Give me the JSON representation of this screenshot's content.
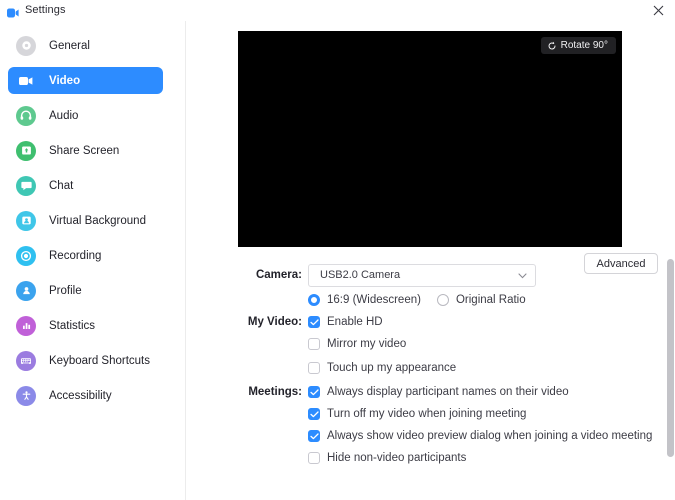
{
  "window": {
    "title": "Settings",
    "app_icon": "zoom-camera-icon",
    "close_icon": "close-icon"
  },
  "sidebar": {
    "items": [
      {
        "label": "General",
        "icon": "gear-icon",
        "color": "#d6d6da",
        "active": false
      },
      {
        "label": "Video",
        "icon": "video-camera-icon",
        "color": "#2d8cff",
        "active": true
      },
      {
        "label": "Audio",
        "icon": "headphones-icon",
        "color": "#5ec98f",
        "active": false
      },
      {
        "label": "Share Screen",
        "icon": "share-screen-icon",
        "color": "#3fbf6f",
        "active": false
      },
      {
        "label": "Chat",
        "icon": "chat-bubble-icon",
        "color": "#3fc7b4",
        "active": false
      },
      {
        "label": "Virtual Background",
        "icon": "virtual-background-icon",
        "color": "#3fc6e8",
        "active": false
      },
      {
        "label": "Recording",
        "icon": "record-circle-icon",
        "color": "#2fc0f0",
        "active": false
      },
      {
        "label": "Profile",
        "icon": "person-icon",
        "color": "#3ba3ee",
        "active": false
      },
      {
        "label": "Statistics",
        "icon": "bar-chart-icon",
        "color": "#c060d8",
        "active": false
      },
      {
        "label": "Keyboard Shortcuts",
        "icon": "keyboard-icon",
        "color": "#9b7ce0",
        "active": false
      },
      {
        "label": "Accessibility",
        "icon": "accessibility-icon",
        "color": "#8b8ae8",
        "active": false
      }
    ]
  },
  "video_preview": {
    "rotate_label": "Rotate 90°",
    "rotate_icon": "rotate-icon",
    "background_color": "#000000"
  },
  "form": {
    "camera": {
      "label": "Camera:",
      "selected": "USB2.0 Camera",
      "chevron_icon": "chevron-down-icon",
      "aspect_ratio": [
        {
          "label": "16:9 (Widescreen)",
          "checked": true
        },
        {
          "label": "Original Ratio",
          "checked": false
        }
      ]
    },
    "my_video": {
      "label": "My Video:",
      "options": [
        {
          "label": "Enable HD",
          "checked": true
        },
        {
          "label": "Mirror my video",
          "checked": false
        },
        {
          "label": "Touch up my appearance",
          "checked": false
        }
      ]
    },
    "meetings": {
      "label": "Meetings:",
      "options": [
        {
          "label": "Always display participant names on their video",
          "checked": true
        },
        {
          "label": "Turn off my video when joining meeting",
          "checked": true
        },
        {
          "label": "Always show video preview dialog when joining a video meeting",
          "checked": true
        },
        {
          "label": "Hide non-video participants",
          "checked": false
        }
      ]
    }
  },
  "footer": {
    "advanced_label": "Advanced"
  },
  "colors": {
    "accent": "#2d8cff",
    "text": "#23232b",
    "border": "#dcdce0"
  }
}
